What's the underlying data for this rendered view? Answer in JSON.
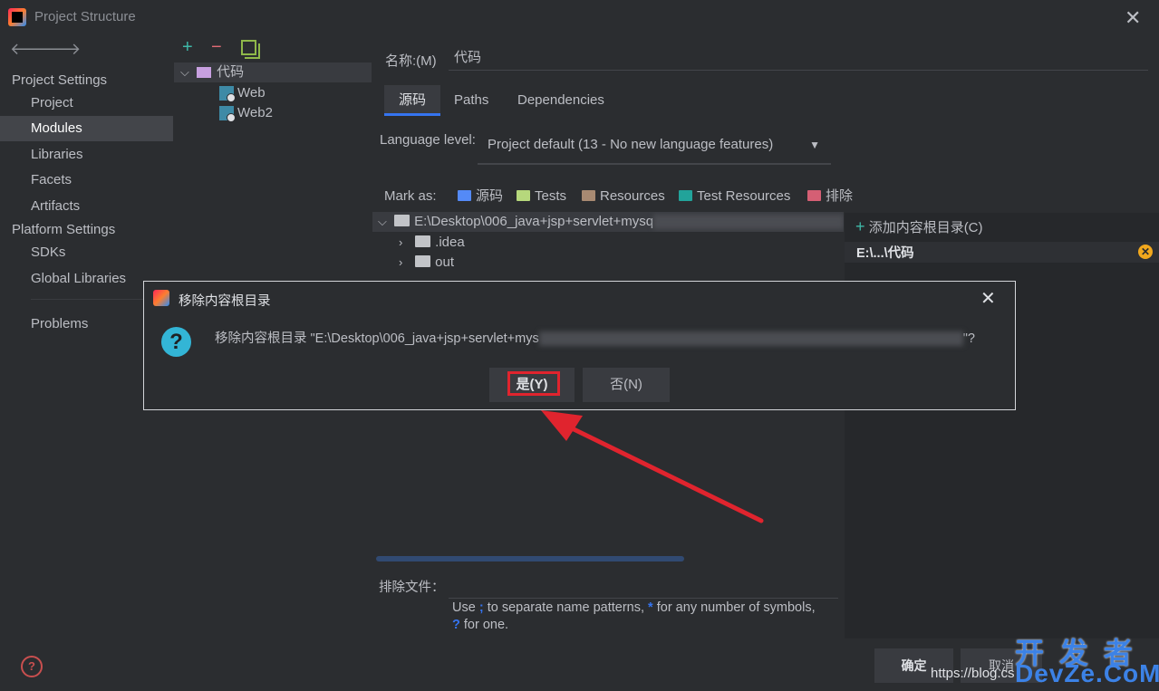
{
  "window": {
    "title": "Project Structure"
  },
  "sidebar": {
    "project_settings": "Project Settings",
    "items_a": [
      {
        "label": "Project"
      },
      {
        "label": "Modules"
      },
      {
        "label": "Libraries"
      },
      {
        "label": "Facets"
      },
      {
        "label": "Artifacts"
      }
    ],
    "platform_settings": "Platform Settings",
    "items_b": [
      {
        "label": "SDKs"
      },
      {
        "label": "Global Libraries"
      }
    ],
    "problems": "Problems",
    "selected": "Modules"
  },
  "module_tree": {
    "root": "代码",
    "children": [
      "Web",
      "Web2"
    ]
  },
  "module": {
    "name_label": "名称:(M)",
    "name_value": "代码",
    "tabs": [
      "源码",
      "Paths",
      "Dependencies"
    ],
    "active_tab": "源码",
    "language_level_label": "Language level:",
    "language_level_value": "Project default (13 - No new language features)",
    "mark_as_label": "Mark as:",
    "mark_as": [
      {
        "label": "源码",
        "color": "#548af7"
      },
      {
        "label": "Tests",
        "color": "#b6d87c"
      },
      {
        "label": "Resources",
        "color": "#a88a72"
      },
      {
        "label": "Test Resources",
        "color": "#22a39a"
      },
      {
        "label": "排除",
        "color": "#d55f74"
      }
    ],
    "file_tree": {
      "root": "E:\\Desktop\\006_java+jsp+servlet+mysq",
      "children": [
        ".idea",
        "out"
      ]
    },
    "add_content_root": "添加内容根目录(C)",
    "content_root": "E:\\...\\代码",
    "exclude_label": "排除文件：",
    "hint_line1_a": "Use",
    "hint_semicolon": ";",
    "hint_line1_b": "to separate name patterns,",
    "hint_star": "*",
    "hint_line1_c": "for any number of symbols,",
    "hint_q": "?",
    "hint_line2": "for one."
  },
  "footer": {
    "ok": "确定",
    "cancel": "取消",
    "url": "https://blog.cs",
    "watermark_cn": "开 发 者",
    "watermark_en": "DevZe.CoM"
  },
  "dialog": {
    "title": "移除内容根目录",
    "message_prefix": "移除内容根目录 \"E:\\Desktop\\006_java+jsp+servlet+mys",
    "message_suffix": "\"?",
    "yes": "是(Y)",
    "no": "否(N)"
  },
  "colors": {
    "background": "#2b2d30",
    "accent": "#3574f0",
    "annotation_red": "#e0242e"
  }
}
